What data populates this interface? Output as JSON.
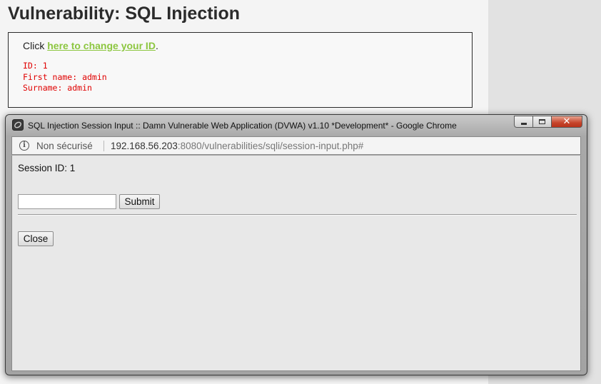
{
  "page": {
    "title": "Vulnerability: SQL Injection",
    "click_prefix": "Click ",
    "link_text": "here to change your ID",
    "click_suffix": ".",
    "results": {
      "id_line": "ID: 1",
      "first_name_line": "First name: admin",
      "surname_line": "Surname: admin"
    }
  },
  "popup": {
    "window_title": "SQL Injection Session Input :: Damn Vulnerable Web Application (DVWA) v1.10 *Development* - Google Chrome",
    "controls": {
      "minimize_icon": "minimize-icon",
      "maximize_icon": "maximize-icon",
      "close_icon": "close-icon",
      "close_glyph": "✕"
    },
    "address_bar": {
      "info_glyph": "i",
      "security_label": "Non sécurisé",
      "url_host": "192.168.56.203",
      "url_rest": ":8080/vulnerabilities/sqli/session-input.php#"
    },
    "content": {
      "session_text": "Session ID: 1",
      "input_value": "",
      "submit_label": "Submit",
      "close_label": "Close"
    }
  },
  "colors": {
    "link": "#8cc63f",
    "result_text": "#e00000",
    "heading": "#2b2b2b"
  }
}
